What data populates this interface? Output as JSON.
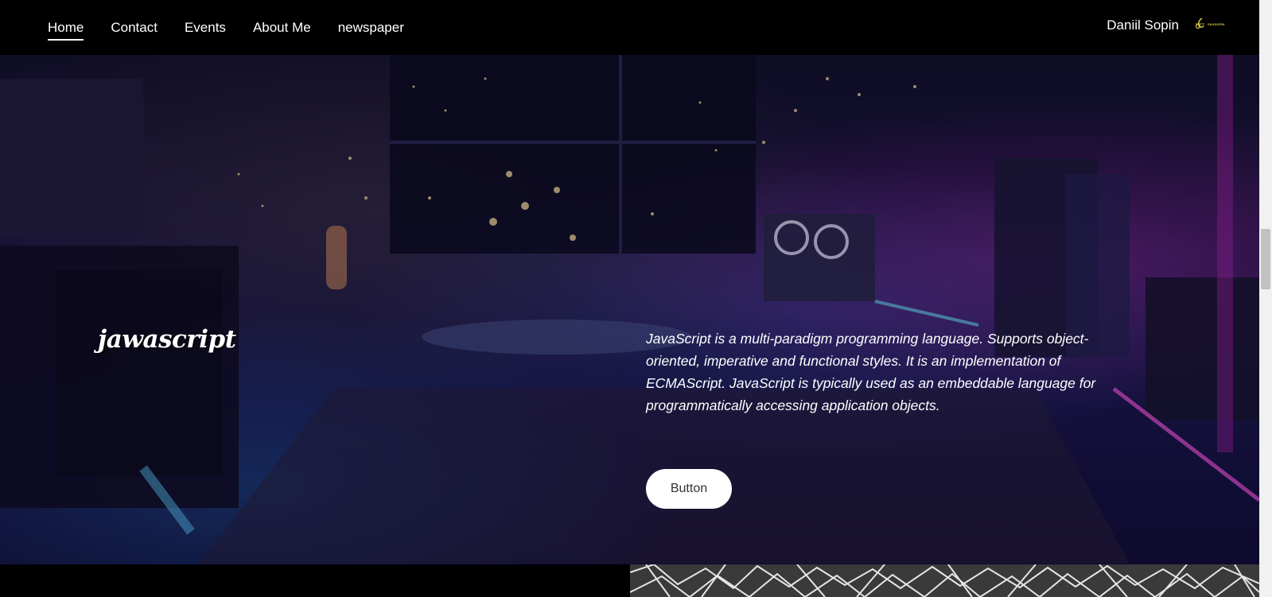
{
  "nav": {
    "items": [
      {
        "label": "Home",
        "active": true
      },
      {
        "label": "Contact",
        "active": false
      },
      {
        "label": "Events",
        "active": false
      },
      {
        "label": "About Me",
        "active": false
      },
      {
        "label": "newspaper",
        "active": false
      }
    ],
    "user_name": "Daniil Sopin",
    "logo_icon": "saxophone-logo-icon",
    "logo_text": "SAXSOPIN"
  },
  "hero": {
    "title": "jawascript",
    "description": "JavaScript is a multi-paradigm programming language. Supports object-oriented, imperative and functional styles. It is an implementation of ECMAScript. JavaScript is typically used as an embeddable language for programmatically accessing application objects.",
    "button_label": "Button"
  },
  "colors": {
    "nav_background": "#000000",
    "hero_tint": "#1b1640",
    "neon_pink": "#d028c8",
    "logo_gold": "#d9c84a"
  }
}
